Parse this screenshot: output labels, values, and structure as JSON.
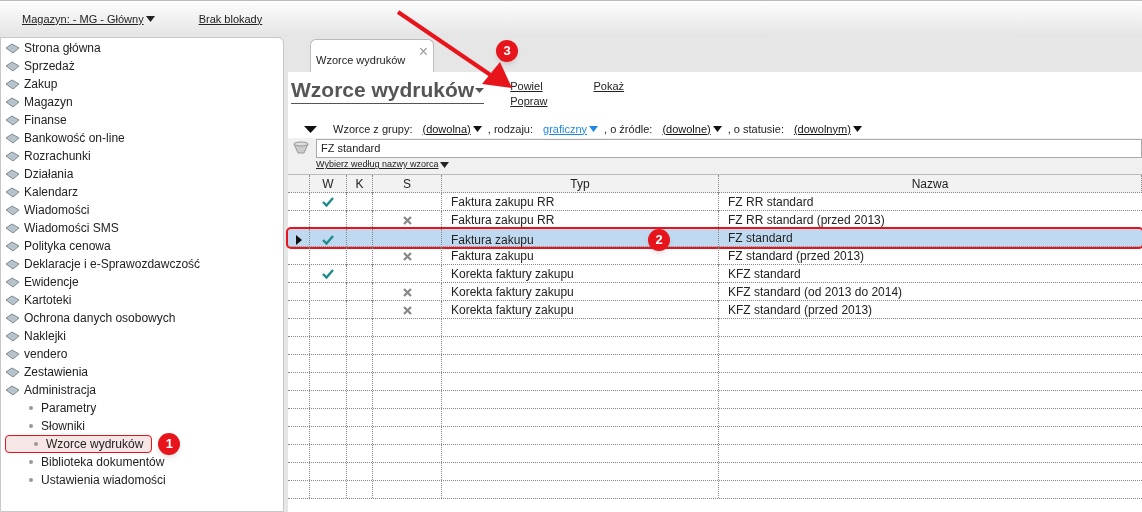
{
  "top_bar": {
    "warehouse": "Magazyn: - MG - Główny",
    "lock": "Brak blokady"
  },
  "sidebar": {
    "items": [
      {
        "label": "Strona główna",
        "selected": false
      },
      {
        "label": "Sprzedaż",
        "selected": false
      },
      {
        "label": "Zakup",
        "selected": false
      },
      {
        "label": "Magazyn",
        "selected": false
      },
      {
        "label": "Finanse",
        "selected": false
      },
      {
        "label": "Bankowość on-line",
        "selected": false
      },
      {
        "label": "Rozrachunki",
        "selected": false
      },
      {
        "label": "Działania",
        "selected": false
      },
      {
        "label": "Kalendarz",
        "selected": false
      },
      {
        "label": "Wiadomości",
        "selected": false
      },
      {
        "label": "Wiadomości SMS",
        "selected": false
      },
      {
        "label": "Polityka cenowa",
        "selected": false
      },
      {
        "label": "Deklaracje i e-Sprawozdawczość",
        "selected": false
      },
      {
        "label": "Ewidencje",
        "selected": false
      },
      {
        "label": "Kartoteki",
        "selected": false
      },
      {
        "label": "Ochrona danych osobowych",
        "selected": false
      },
      {
        "label": "Naklejki",
        "selected": false
      },
      {
        "label": "vendero",
        "selected": false
      },
      {
        "label": "Zestawienia",
        "selected": false
      },
      {
        "label": "Administracja",
        "selected": false,
        "children": [
          {
            "label": "Parametry",
            "selected": false
          },
          {
            "label": "Słowniki",
            "selected": false
          },
          {
            "label": "Wzorce wydruków",
            "selected": true,
            "callout": "1"
          },
          {
            "label": "Biblioteka dokumentów",
            "selected": false
          },
          {
            "label": "Ustawienia wiadomości",
            "selected": false
          }
        ]
      }
    ]
  },
  "tabs": [
    {
      "label": "Wzorce wydruków",
      "selected": true,
      "close": "×"
    }
  ],
  "page": {
    "title": "Wzorce wydruków",
    "actions": [
      {
        "label": "Powiel",
        "callout": "3"
      },
      {
        "label": "Popraw"
      },
      {
        "label": "Pokaż"
      }
    ]
  },
  "filter": [
    {
      "text": "Wzorce z grupy:"
    },
    {
      "value": "(dowolna)",
      "kind": "plain"
    },
    {
      "text": ", rodzaju:"
    },
    {
      "value": "graficzny",
      "kind": "link"
    },
    {
      "text": ", o źródle:"
    },
    {
      "value": "(dowolne)",
      "kind": "plain"
    },
    {
      "text": ", o statusie:"
    },
    {
      "value": "(dowolnym)",
      "kind": "plain"
    }
  ],
  "search": {
    "value": "FZ standard",
    "mode": "Wybierz według nazwy wzorca"
  },
  "table": {
    "columns": [
      "W",
      "K",
      "S",
      "Typ",
      "Nazwa"
    ],
    "rows": [
      {
        "w": true,
        "s": false,
        "typ": "Faktura zakupu RR",
        "nazwa": "FZ RR standard",
        "selected": false
      },
      {
        "w": false,
        "s": true,
        "typ": "Faktura zakupu RR",
        "nazwa": "FZ RR standard (przed 2013)",
        "selected": false
      },
      {
        "w": true,
        "s": false,
        "typ": "Faktura zakupu",
        "nazwa": "FZ standard",
        "selected": true,
        "callout": "2"
      },
      {
        "w": false,
        "s": true,
        "typ": "Faktura zakupu",
        "nazwa": "FZ standard (przed 2013)",
        "selected": false
      },
      {
        "w": true,
        "s": false,
        "typ": "Korekta faktury zakupu",
        "nazwa": "KFZ standard",
        "selected": false
      },
      {
        "w": false,
        "s": true,
        "typ": "Korekta faktury zakupu",
        "nazwa": "KFZ standard (od 2013 do 2014)",
        "selected": false
      },
      {
        "w": false,
        "s": true,
        "typ": "Korekta faktury zakupu",
        "nazwa": "KFZ standard (przed 2013)",
        "selected": false
      }
    ]
  }
}
